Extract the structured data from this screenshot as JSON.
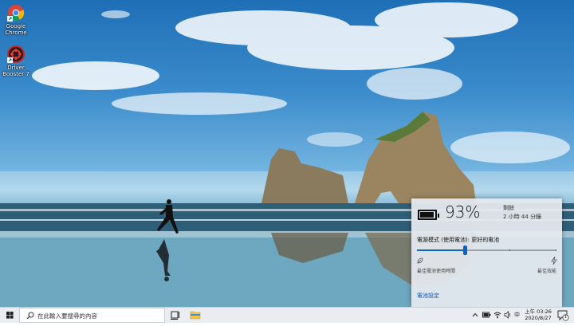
{
  "desktop": {
    "icons": [
      {
        "name": "chrome-icon",
        "label": "Google Chrome"
      },
      {
        "name": "driver-booster-icon",
        "label": "Driver Booster 7"
      }
    ]
  },
  "battery_flyout": {
    "percent": "93%",
    "remaining_title": "剩餘",
    "remaining_value": "2 小時 44 分鐘",
    "mode_label": "電源模式 (使用電池): 更好的電池",
    "slider_level": 0.34,
    "left_caption": "最佳電池使用時間",
    "right_caption": "最佳效能",
    "settings_link": "電池設定"
  },
  "taskbar": {
    "search_placeholder": "在此輸入要搜尋的內容",
    "tray": {
      "ime": "中",
      "time": "上午 03:26",
      "date": "2020/8/27",
      "notification_count": "1"
    }
  },
  "colors": {
    "accent": "#0a64c8",
    "link": "#0b57b0",
    "taskbar": "#e9edf1"
  }
}
